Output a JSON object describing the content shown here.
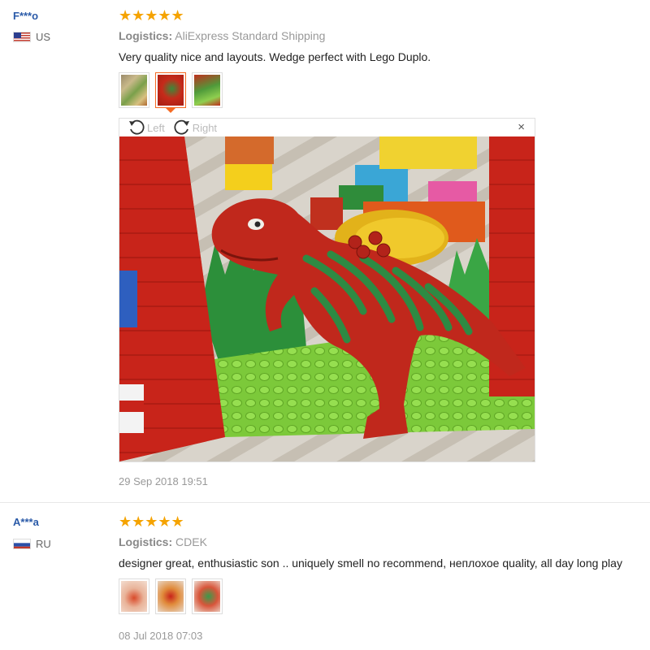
{
  "reviews": [
    {
      "user": "F***o",
      "country": "US",
      "stars": "★★★★★",
      "logistics_label": "Logistics:",
      "logistics_value": "AliExpress Standard Shipping",
      "text": "Very quality nice and layouts. Wedge perfect with Lego Duplo.",
      "date": "29 Sep 2018 19:51",
      "viewer": {
        "rotate_left": "Left",
        "rotate_right": "Right",
        "close": "×"
      }
    },
    {
      "user": "A***a",
      "country": "RU",
      "stars": "★★★★★",
      "logistics_label": "Logistics:",
      "logistics_value": "CDEK",
      "text": "designer great, enthusiastic son .. uniquely smell no recommend, неплохое quality, all day long play",
      "date": "08 Jul 2018 07:03"
    }
  ],
  "colors": {
    "accent_star": "#f5a300",
    "user_link": "#2a5aa8",
    "active_thumb": "#f56a23"
  },
  "icons": [
    "rotate-left-icon",
    "rotate-right-icon",
    "close-icon",
    "us-flag-icon",
    "ru-flag-icon"
  ]
}
